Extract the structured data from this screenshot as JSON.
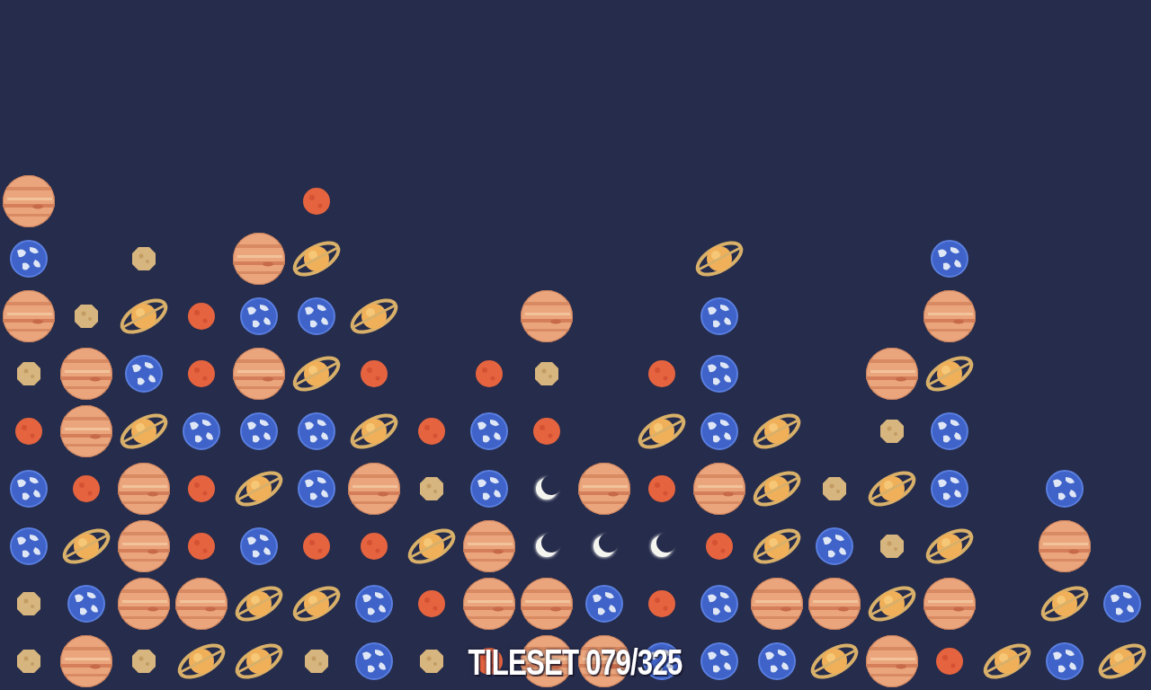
{
  "board": {
    "rows": [
      [
        "jupiter",
        "empty",
        "empty",
        "empty",
        "empty",
        "mars",
        "empty",
        "empty",
        "empty",
        "empty",
        "empty",
        "empty",
        "empty",
        "empty",
        "empty",
        "empty",
        "empty",
        "empty",
        "empty",
        "empty"
      ],
      [
        "earth",
        "empty",
        "rock",
        "empty",
        "jupiter",
        "saturn",
        "empty",
        "empty",
        "empty",
        "empty",
        "empty",
        "empty",
        "saturn",
        "empty",
        "empty",
        "empty",
        "earth",
        "empty",
        "empty",
        "empty"
      ],
      [
        "jupiter",
        "rock",
        "saturn",
        "mars",
        "earth",
        "earth",
        "saturn",
        "empty",
        "empty",
        "jupiter",
        "empty",
        "empty",
        "earth",
        "empty",
        "empty",
        "empty",
        "jupiter",
        "empty",
        "empty",
        "empty"
      ],
      [
        "rock",
        "jupiter",
        "earth",
        "mars",
        "jupiter",
        "saturn",
        "mars",
        "empty",
        "mars",
        "rock",
        "empty",
        "mars",
        "earth",
        "empty",
        "empty",
        "jupiter",
        "saturn",
        "empty",
        "empty",
        "empty"
      ],
      [
        "mars",
        "jupiter",
        "saturn",
        "earth",
        "earth",
        "earth",
        "saturn",
        "mars",
        "earth",
        "mars",
        "empty",
        "saturn",
        "earth",
        "saturn",
        "empty",
        "rock",
        "earth",
        "empty",
        "empty",
        "empty"
      ],
      [
        "earth",
        "mars",
        "jupiter",
        "mars",
        "saturn",
        "earth",
        "jupiter",
        "rock",
        "earth",
        "moon",
        "jupiter",
        "mars",
        "jupiter",
        "saturn",
        "rock",
        "saturn",
        "earth",
        "empty",
        "earth",
        "empty"
      ],
      [
        "earth",
        "saturn",
        "jupiter",
        "mars",
        "earth",
        "mars",
        "mars",
        "saturn",
        "jupiter",
        "moon",
        "moon",
        "moon",
        "mars",
        "saturn",
        "earth",
        "rock",
        "saturn",
        "empty",
        "jupiter",
        "empty"
      ],
      [
        "rock",
        "earth",
        "jupiter",
        "jupiter",
        "saturn",
        "saturn",
        "earth",
        "mars",
        "jupiter",
        "jupiter",
        "earth",
        "mars",
        "earth",
        "jupiter",
        "jupiter",
        "saturn",
        "jupiter",
        "empty",
        "saturn",
        "earth"
      ],
      [
        "rock",
        "jupiter",
        "rock",
        "saturn",
        "saturn",
        "rock",
        "earth",
        "rock",
        "mars",
        "jupiter",
        "jupiter",
        "earth",
        "earth",
        "earth",
        "saturn",
        "jupiter",
        "mars",
        "saturn",
        "earth",
        "saturn"
      ]
    ]
  },
  "label": "TILESET 079/325"
}
